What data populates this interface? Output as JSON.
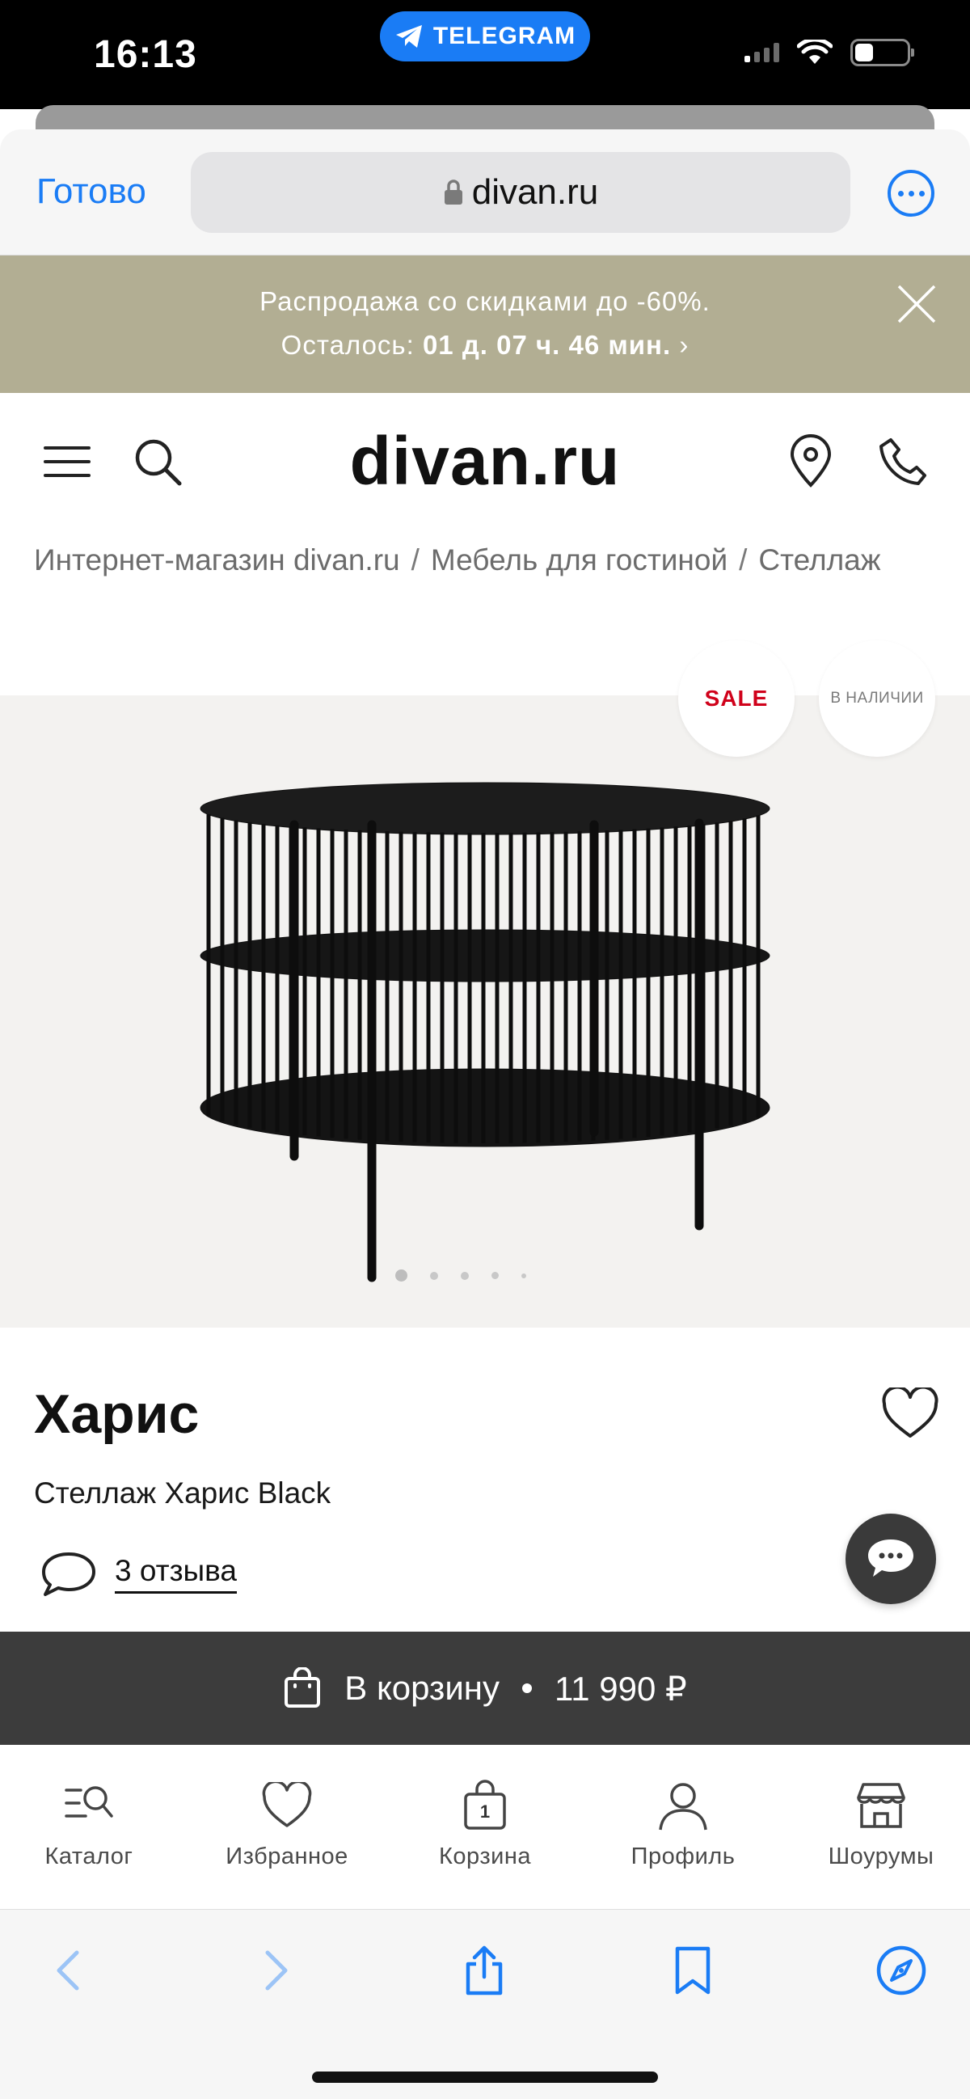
{
  "status_bar": {
    "time": "16:13",
    "app_pill": "TELEGRAM"
  },
  "browser": {
    "done_label": "Готово",
    "url": "divan.ru"
  },
  "promo": {
    "line1": "Распродажа со скидками до -60%.",
    "line2_prefix": "Осталось:",
    "countdown": "01 д. 07 ч. 46 мин.",
    "chevron": "›"
  },
  "header": {
    "logo": "divan.ru"
  },
  "breadcrumb": [
    "Интернет-магазин divan.ru",
    "Мебель для гостиной",
    "Стеллаж"
  ],
  "badges": {
    "sale": "SALE",
    "stock": "В НАЛИЧИИ"
  },
  "gallery": {
    "slides": 5,
    "active_slide": 1
  },
  "product": {
    "title": "Харис",
    "subtitle": "Стеллаж Харис Black",
    "reviews": "3 отзыва"
  },
  "cart_bar": {
    "label": "В корзину",
    "price": "11 990 ₽"
  },
  "tabs": [
    {
      "label": "Каталог",
      "icon": "catalog-search-icon"
    },
    {
      "label": "Избранное",
      "icon": "heart-icon"
    },
    {
      "label": "Корзина",
      "icon": "shopping-bag-icon",
      "count": "1"
    },
    {
      "label": "Профиль",
      "icon": "user-icon"
    },
    {
      "label": "Шоурумы",
      "icon": "store-icon"
    }
  ],
  "colors": {
    "promo_bg": "#b2ae93",
    "cart_bar_bg": "#3c3c3c",
    "ios_blue": "#1a7cf5",
    "sale_red": "#d0021b",
    "gallery_bg": "#f3f2f0"
  }
}
